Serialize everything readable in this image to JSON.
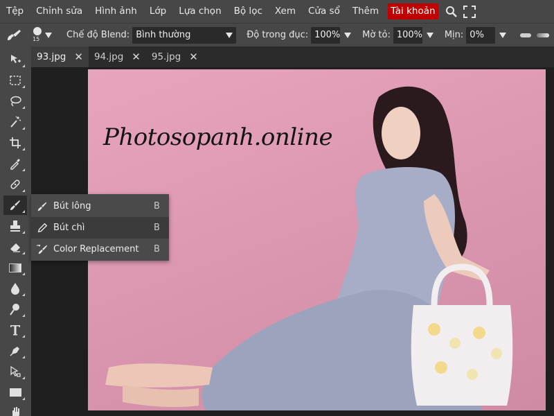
{
  "menu": {
    "items": [
      "Tệp",
      "Chỉnh sửa",
      "Hình ảnh",
      "Lớp",
      "Lựa chọn",
      "Bộ lọc",
      "Xem",
      "Cửa sổ",
      "Thêm"
    ],
    "account": "Tài khoản",
    "account_color": "#c00000"
  },
  "options": {
    "brush_size": "15",
    "blend_label": "Chế độ Blend:",
    "blend_value": "Bình thường",
    "opacity_label": "Độ trong đục:",
    "opacity_value": "100%",
    "flow_label": "Mờ tỏ:",
    "flow_value": "100%",
    "smooth_label": "Mịn:",
    "smooth_value": "0%"
  },
  "tabs": [
    {
      "label": "93.jpg"
    },
    {
      "label": "94.jpg"
    },
    {
      "label": "95.jpg"
    }
  ],
  "canvas": {
    "watermark": "Photosopanh.online",
    "background_color": "#e3a0b8"
  },
  "flyout": {
    "items": [
      {
        "label": "Bút lông",
        "shortcut": "B",
        "icon": "brush-icon"
      },
      {
        "label": "Bút chì",
        "shortcut": "B",
        "icon": "pencil-icon"
      },
      {
        "label": "Color Replacement",
        "shortcut": "B",
        "icon": "color-replacement-icon"
      }
    ]
  },
  "toolbar": {
    "tools": [
      "move",
      "marquee",
      "lasso",
      "magic-wand",
      "crop",
      "eyedropper",
      "healing",
      "brush",
      "stamp",
      "eraser",
      "gradient",
      "blur",
      "dodge",
      "type",
      "pen",
      "path-select",
      "rectangle",
      "hand"
    ],
    "active": "brush"
  }
}
